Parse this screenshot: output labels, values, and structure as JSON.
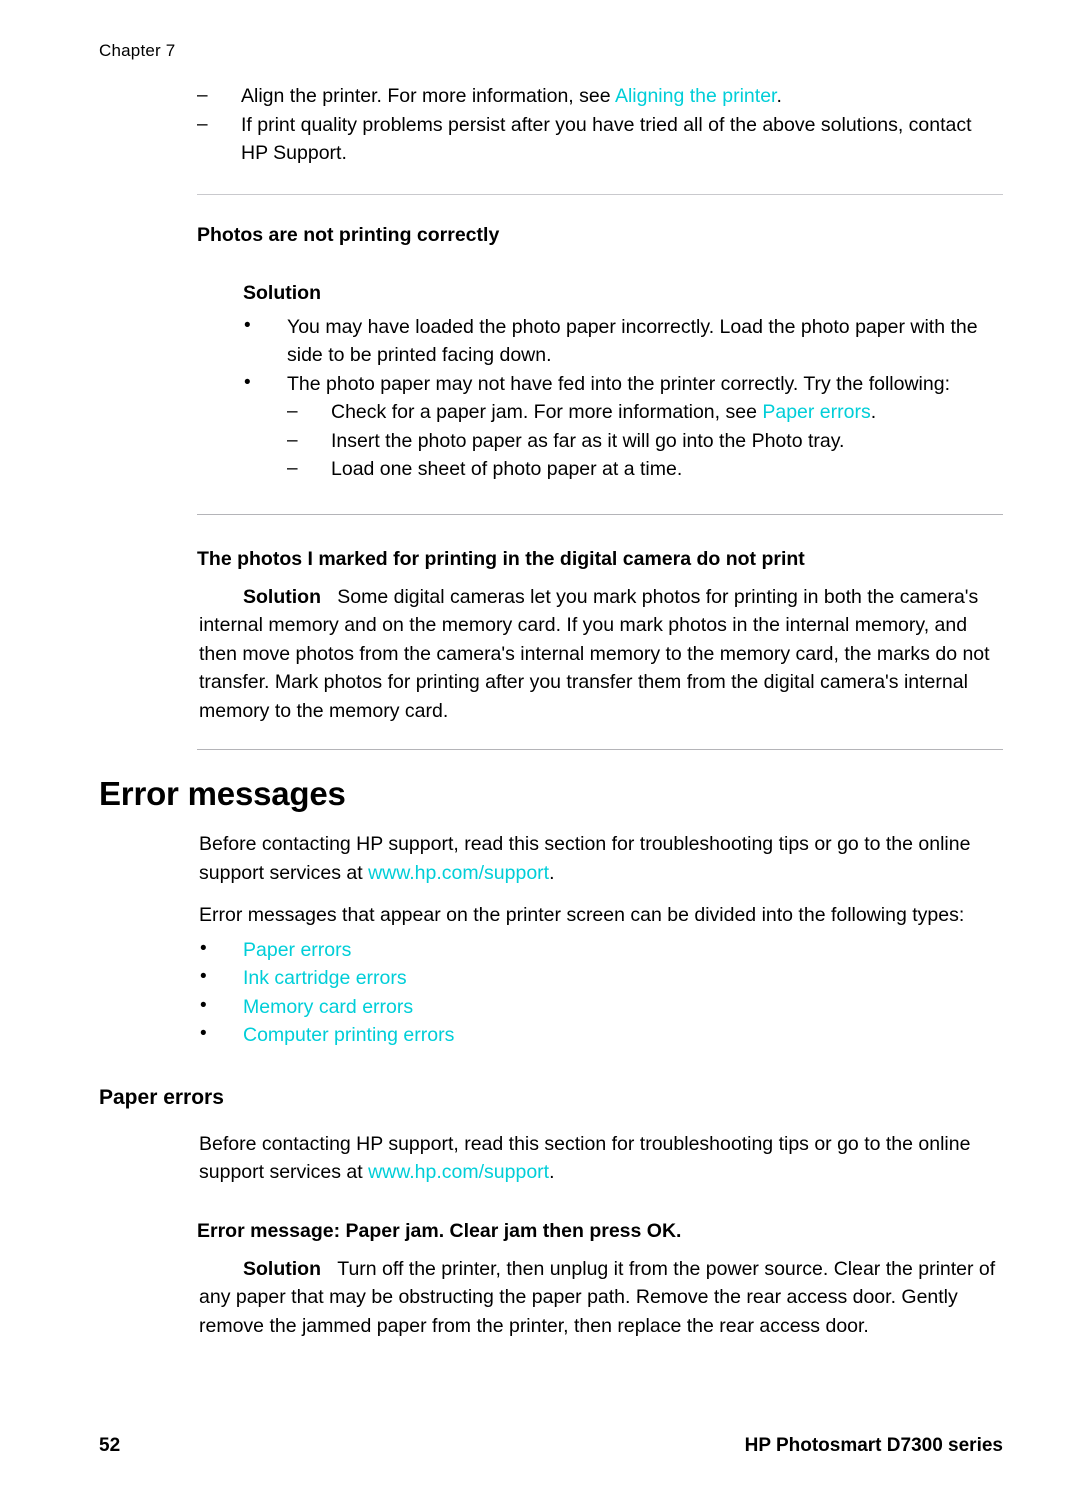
{
  "header": {
    "chapter_label": "Chapter 7"
  },
  "colors": {
    "link": "#00CED8",
    "text": "#000000",
    "rule": "#b4b4b8",
    "background": "#ffffff"
  },
  "top_list": {
    "items": [
      {
        "before": "Align the printer. For more information, see ",
        "link": "Aligning the printer",
        "after": "."
      },
      {
        "before": "If print quality problems persist after you have tried all of the above solutions, contact HP Support.",
        "link": "",
        "after": ""
      }
    ]
  },
  "section_photos_not_printing": {
    "heading": "Photos are not printing correctly",
    "solution_label": "Solution",
    "bullets": [
      {
        "text": "You may have loaded the photo paper incorrectly. Load the photo paper with the side to be printed facing down."
      },
      {
        "text": "The photo paper may not have fed into the printer correctly. Try the following:",
        "sub_items": [
          {
            "before": "Check for a paper jam. For more information, see ",
            "link": "Paper errors",
            "after": "."
          },
          {
            "before": "Insert the photo paper as far as it will go into the Photo tray.",
            "link": "",
            "after": ""
          },
          {
            "before": "Load one sheet of photo paper at a time.",
            "link": "",
            "after": ""
          }
        ]
      }
    ]
  },
  "section_marked_photos": {
    "heading": "The photos I marked for printing in the digital camera do not print",
    "solution_label": "Solution",
    "solution_body": "Some digital cameras let you mark photos for printing in both the camera's internal memory and on the memory card. If you mark photos in the internal memory, and then move photos from the camera's internal memory to the memory card, the marks do not transfer. Mark photos for printing after you transfer them from the digital camera's internal memory to the memory card."
  },
  "section_error_messages": {
    "heading": "Error messages",
    "intro_before": "Before contacting HP support, read this section for troubleshooting tips or go to the online support services at ",
    "intro_link": "www.hp.com/support",
    "intro_after": ".",
    "types_intro": "Error messages that appear on the printer screen can be divided into the following types:",
    "type_links": [
      "Paper errors",
      "Ink cartridge errors",
      "Memory card errors",
      "Computer printing errors"
    ]
  },
  "section_paper_errors": {
    "heading": "Paper errors",
    "intro_before": "Before contacting HP support, read this section for troubleshooting tips or go to the online support services at ",
    "intro_link": "www.hp.com/support",
    "intro_after": ".",
    "error_heading": "Error message: Paper jam. Clear jam then press OK.",
    "solution_label": "Solution",
    "solution_body": "Turn off the printer, then unplug it from the power source. Clear the printer of any paper that may be obstructing the paper path. Remove the rear access door. Gently remove the jammed paper from the printer, then replace the rear access door."
  },
  "footer": {
    "page_number": "52",
    "product": "HP Photosmart D7300 series"
  }
}
